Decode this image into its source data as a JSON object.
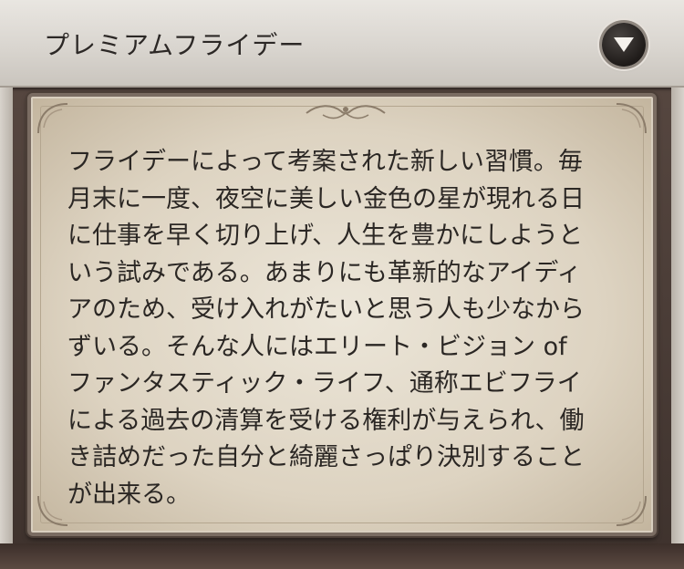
{
  "header": {
    "title": "プレミアムフライデー",
    "toggle_icon": "chevron-down-icon"
  },
  "panel": {
    "lines": [
      "フライデーによって考案された新しい習慣。毎",
      "月末に一度、夜空に美しい金色の星が現れる日",
      "に仕事を早く切り上げ、人生を豊かにしようと",
      "いう試みである。あまりにも革新的なアイディ",
      "アのため、受け入れがたいと思う人も少なから",
      "ずいる。そんな人にはエリート・ビジョン of",
      "ファンタスティック・ライフ、通称エビフライ",
      "による過去の清算を受ける権利が与えられ、働",
      "き詰めだった自分と綺麗さっぱり決別すること",
      "が出来る。"
    ]
  },
  "colors": {
    "header_bg": "#dcd8d2",
    "panel_bg": "#e2d9c8",
    "text": "#2b2724",
    "frame": "#4a3d37"
  }
}
